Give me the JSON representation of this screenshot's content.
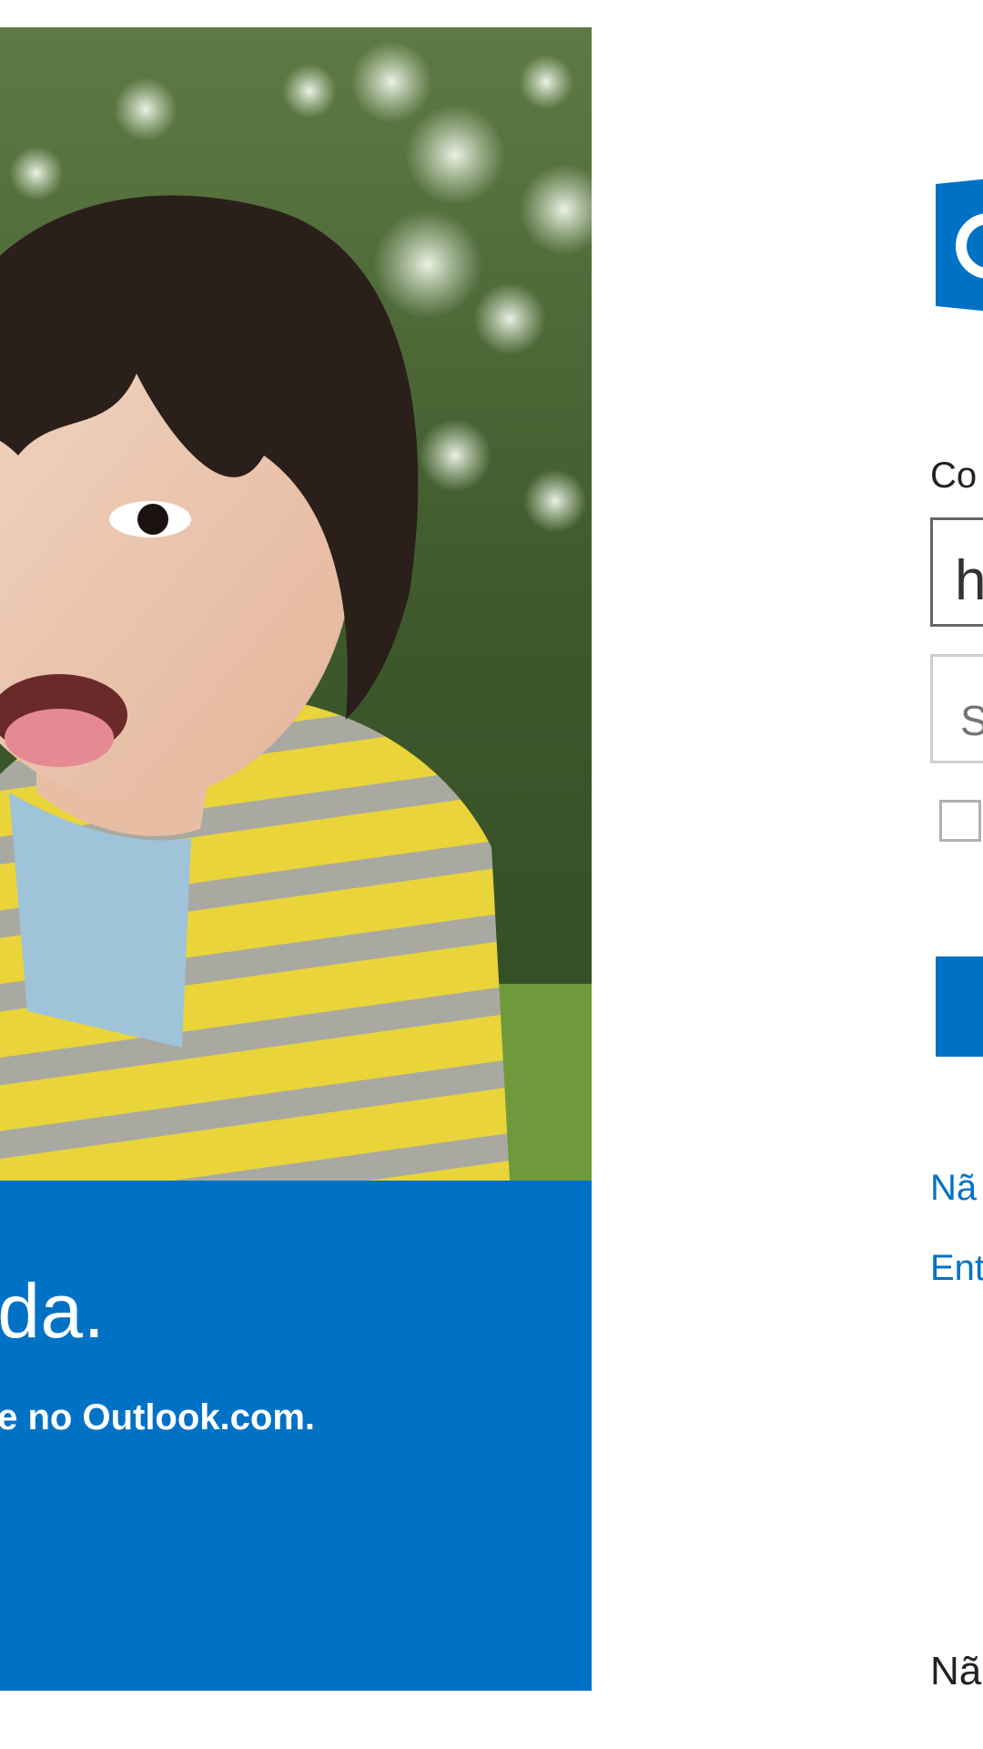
{
  "hero": {
    "headline": "ada.",
    "subtitle": "le no Outlook.com."
  },
  "signin": {
    "logo_icon": "outlook-logo-icon",
    "brand_color": "#0072c6",
    "field_label": "Co",
    "email_value": "h",
    "password_placeholder": "S",
    "link_1": "Nã",
    "link_2": "Ent",
    "bottom_text": "Nã"
  }
}
